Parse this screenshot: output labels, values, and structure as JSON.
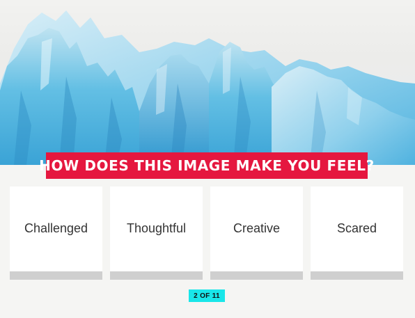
{
  "hero": {
    "image": "iceberg-glacier-photo"
  },
  "question": {
    "text": "HOW DOES THIS IMAGE MAKE YOU FEEL?"
  },
  "options": [
    {
      "label": "Challenged"
    },
    {
      "label": "Thoughtful"
    },
    {
      "label": "Creative"
    },
    {
      "label": "Scared"
    }
  ],
  "progress": {
    "text": "2 OF 11",
    "current": 2,
    "total": 11
  },
  "colors": {
    "banner": "#e5173f",
    "counter": "#19e6e9",
    "background": "#f5f5f3"
  }
}
